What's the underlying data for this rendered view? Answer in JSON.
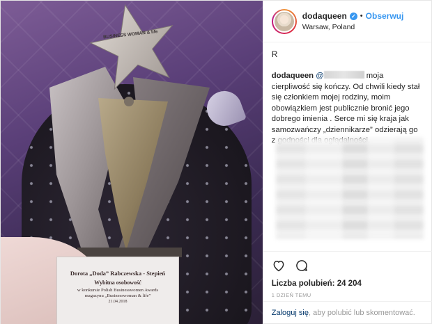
{
  "post": {
    "photo": {
      "award_logo_text": "BUSINESS WOMAN & life",
      "plaque": {
        "line1": "Dorota „Doda” Rabczewska - Stepień",
        "line2": "Wybitna osobowość",
        "line3": "w konkursie Polish Businesswomen Awards",
        "line4": "magazynu „Businesswoman & life”",
        "line5": "21.04.2018"
      }
    },
    "header": {
      "username": "dodaqueen",
      "verified_icon": "verified-badge-icon",
      "separator": "•",
      "follow_label": "Obserwuj",
      "location": "Warsaw, Poland"
    },
    "first_comment": "R",
    "caption": {
      "username": "dodaqueen",
      "mention_prefix": "@",
      "text": "moja cierpliwość się kończy. Od chwili kiedy stał się członkiem mojej rodziny, moim obowiązkiem jest publicznie bronić jego dobrego imienia . Serce mi się kraja jak samozwańczy „dziennikarze” odzierają go z godności dla oglądalności."
    },
    "actions": {
      "like_icon": "heart-icon",
      "comment_icon": "comment-icon",
      "likes_text": "Liczba polubień: 24 204",
      "time_text": "1 DZIEŃ TEMU"
    },
    "login_prompt": {
      "link_text": "Zaloguj się",
      "rest_text": ", aby polubić lub skomentować."
    }
  },
  "colors": {
    "link_blue": "#3897f0",
    "mention_navy": "#003569",
    "muted_gray": "#999999",
    "text": "#262626"
  }
}
